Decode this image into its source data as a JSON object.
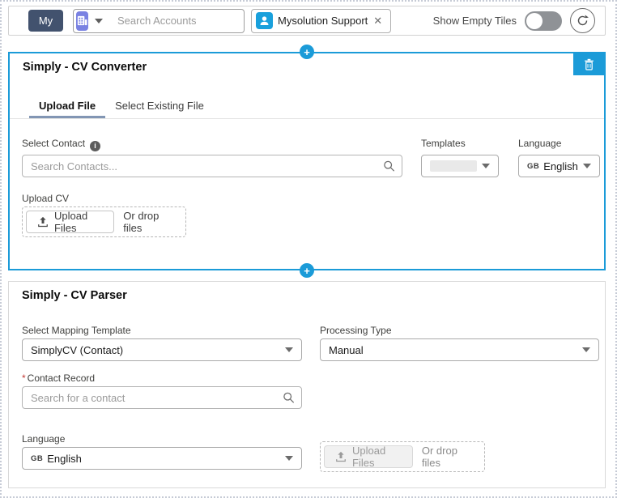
{
  "toolbar": {
    "my_button_label": "My",
    "account_search_placeholder": "Search Accounts",
    "selected_filter_pill": "Mysolution Support",
    "show_empty_tiles_label": "Show Empty Tiles",
    "empty_tiles_toggle_state": "off"
  },
  "converter": {
    "title": "Simply - CV Converter",
    "tabs": [
      {
        "label": "Upload File",
        "active": true
      },
      {
        "label": "Select Existing File",
        "active": false
      }
    ],
    "select_contact_label": "Select Contact",
    "contact_search_placeholder": "Search Contacts...",
    "templates_label": "Templates",
    "templates_value": "",
    "language_label": "Language",
    "language_code": "GB",
    "language_value": "English",
    "upload_cv_label": "Upload CV",
    "upload_button_label": "Upload Files",
    "drop_files_text": "Or drop files"
  },
  "parser": {
    "title": "Simply - CV Parser",
    "mapping_template_label": "Select Mapping Template",
    "mapping_template_value": "SimplyCV (Contact)",
    "processing_type_label": "Processing Type",
    "processing_type_value": "Manual",
    "required_marker": "*",
    "contact_record_label": "Contact Record",
    "contact_search_placeholder": "Search for a contact",
    "language_label": "Language",
    "language_code": "GB",
    "language_value": "English",
    "upload_button_label": "Upload Files",
    "upload_button_disabled": true,
    "drop_files_text": "Or drop files"
  },
  "icons": {
    "app_launcher": "building-grid",
    "dropdown": "caret-down",
    "search": "magnifier",
    "contact": "person",
    "remove": "✕",
    "toggle": "switch-off",
    "refresh": "⟳",
    "add_tile": "+",
    "delete_tile": "trash",
    "info": "ⓘ",
    "upload": "tray-arrow-up"
  },
  "colors": {
    "accent_blue": "#1b9bd8",
    "navy": "#42526e",
    "app_purple": "#7a82e2",
    "contact_blue": "#19a0dc",
    "tab_underline": "#8296b4",
    "required_red": "#c23934"
  }
}
